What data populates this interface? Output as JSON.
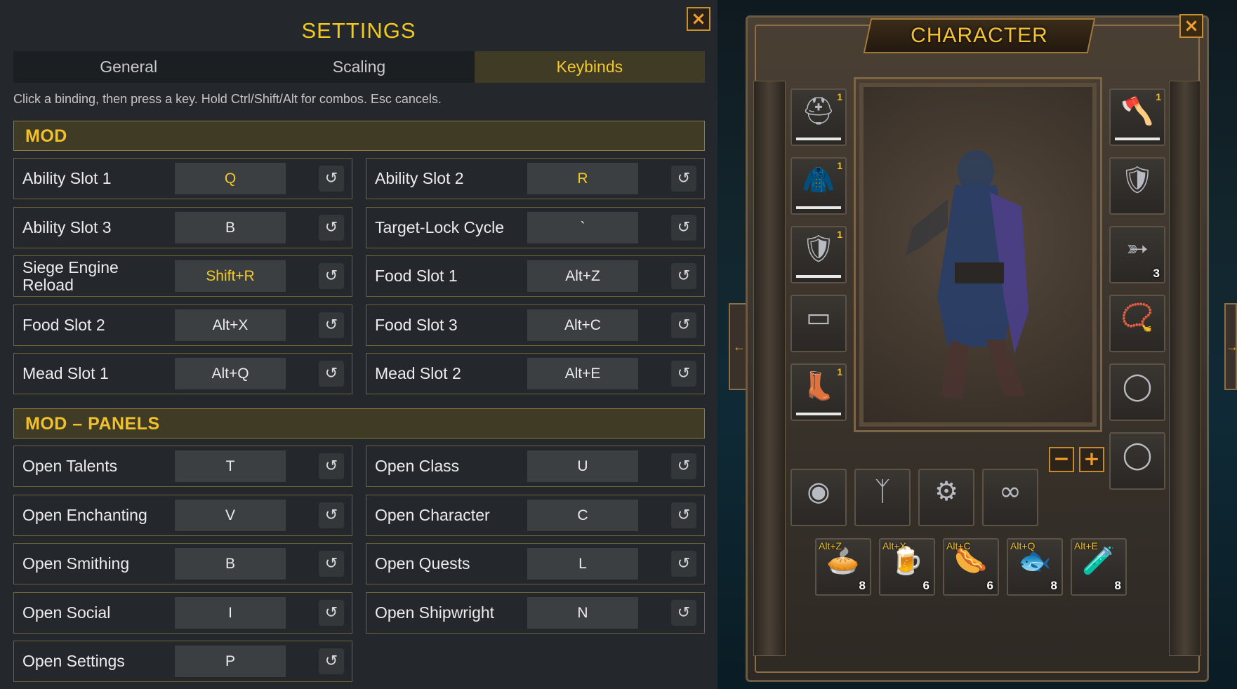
{
  "settings": {
    "title": "SETTINGS",
    "close_icon": "close-icon",
    "tabs": [
      {
        "label": "General",
        "active": false
      },
      {
        "label": "Scaling",
        "active": false
      },
      {
        "label": "Keybinds",
        "active": true
      }
    ],
    "hint": "Click a binding, then press a key. Hold Ctrl/Shift/Alt for combos. Esc cancels.",
    "reset_glyph": "↺",
    "sections": [
      {
        "title": "MOD",
        "bindings": [
          {
            "label": "Ability Slot 1",
            "key": "Q",
            "highlight": true
          },
          {
            "label": "Ability Slot 2",
            "key": "R",
            "highlight": true
          },
          {
            "label": "Ability Slot 3",
            "key": "B"
          },
          {
            "label": "Target-Lock Cycle",
            "key": "`"
          },
          {
            "label": "Siege Engine Reload",
            "key": "Shift+R",
            "highlight": true
          },
          {
            "label": "Food Slot 1",
            "key": "Alt+Z"
          },
          {
            "label": "Food Slot 2",
            "key": "Alt+X"
          },
          {
            "label": "Food Slot 3",
            "key": "Alt+C"
          },
          {
            "label": "Mead Slot 1",
            "key": "Alt+Q"
          },
          {
            "label": "Mead Slot 2",
            "key": "Alt+E"
          }
        ]
      },
      {
        "title": "MOD – PANELS",
        "bindings": [
          {
            "label": "Open Talents",
            "key": "T"
          },
          {
            "label": "Open Class",
            "key": "U"
          },
          {
            "label": "Open Enchanting",
            "key": "V"
          },
          {
            "label": "Open Character",
            "key": "C"
          },
          {
            "label": "Open Smithing",
            "key": "B"
          },
          {
            "label": "Open Quests",
            "key": "L"
          },
          {
            "label": "Open Social",
            "key": "I"
          },
          {
            "label": "Open Shipwright",
            "key": "N"
          },
          {
            "label": "Open Settings",
            "key": "P"
          }
        ]
      }
    ],
    "colors": {
      "accent": "#f2c91f",
      "panel": "#24282c",
      "section": "#403b24"
    }
  },
  "character": {
    "title": "CHARACTER",
    "close_icon": "close-icon",
    "zoom_out": "−",
    "zoom_in": "+",
    "left_slots": [
      {
        "icon": "helmet-icon",
        "glyph": "⛑",
        "count": "1"
      },
      {
        "icon": "cape-icon",
        "glyph": "🧥",
        "count": "1"
      },
      {
        "icon": "chest-armor-icon",
        "glyph": "🛡",
        "count": "1"
      },
      {
        "icon": "belt-icon",
        "glyph": "▭",
        "count": ""
      },
      {
        "icon": "legs-armor-icon",
        "glyph": "👢",
        "count": "1"
      }
    ],
    "right_slots": [
      {
        "icon": "axe-icon",
        "glyph": "🪓",
        "count": "1"
      },
      {
        "icon": "shield-icon",
        "glyph": "🛡",
        "count": ""
      },
      {
        "icon": "arrow-icon",
        "glyph": "➳",
        "qty": "3"
      },
      {
        "icon": "necklace-icon",
        "glyph": "📿",
        "count": ""
      },
      {
        "icon": "ring-icon",
        "glyph": "◯",
        "count": ""
      },
      {
        "icon": "ring-icon",
        "glyph": "◯",
        "count": ""
      }
    ],
    "bottom_slots": [
      {
        "icon": "amulet-icon",
        "glyph": "◉"
      },
      {
        "icon": "wishbone-icon",
        "glyph": "ᛉ"
      },
      {
        "icon": "utility-icon",
        "glyph": "⚙"
      },
      {
        "icon": "bracelet-icon",
        "glyph": "∞"
      }
    ],
    "consumables": [
      {
        "icon": "food-icon",
        "glyph": "🥧",
        "bind": "Alt+Z",
        "qty": "8"
      },
      {
        "icon": "food-icon",
        "glyph": "🍺",
        "bind": "Alt+X",
        "qty": "6"
      },
      {
        "icon": "sausage-icon",
        "glyph": "🌭",
        "bind": "Alt+C",
        "qty": "6"
      },
      {
        "icon": "fish-icon",
        "glyph": "🐟",
        "bind": "Alt+Q",
        "qty": "8"
      },
      {
        "icon": "mead-icon",
        "glyph": "🧪",
        "bind": "Alt+E",
        "qty": "8"
      }
    ]
  }
}
